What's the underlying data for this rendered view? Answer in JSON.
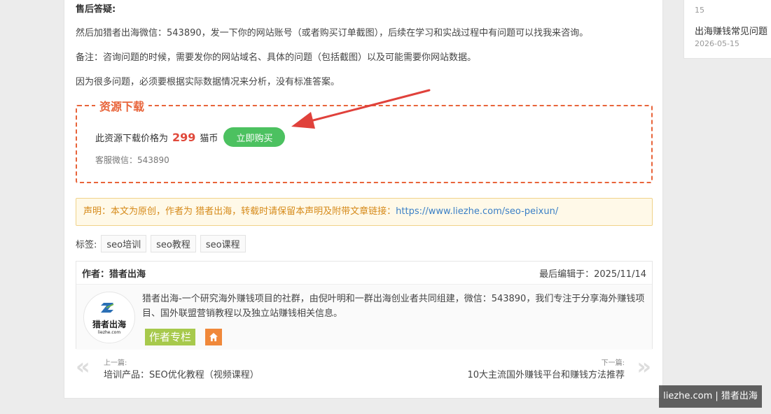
{
  "article": {
    "heading": "售后答疑:",
    "para1": "然后加猎者出海微信：543890，发一下你的网站账号（或者购买订单截图），后续在学习和实战过程中有问题可以找我来咨询。",
    "para2": "备注：咨询问题的时候，需要发你的网站域名、具体的问题（包括截图）以及可能需要你网站数据。",
    "para3": "因为很多问题，必须要根据实际数据情况来分析，没有标准答案。"
  },
  "download": {
    "title": "资源下载",
    "price_prefix": "此资源下载价格为",
    "price": "299",
    "price_unit": "猫币",
    "buy_label": "立即购买",
    "service": "客服微信：543890"
  },
  "notice": {
    "text": "声明：本文为原创，作者为 猎者出海，转载时请保留本声明及附带文章链接：",
    "link": "https://www.liezhe.com/seo-peixun/"
  },
  "tags": {
    "label": "标签:",
    "items": [
      "seo培训",
      "seo教程",
      "seo课程"
    ]
  },
  "author": {
    "name_label": "作者：猎者出海",
    "last_edit": "最后编辑于：2025/11/14",
    "logo_name": "猎者出海",
    "logo_domain": "liezhe.com",
    "description": "猎者出海-一个研究海外赚钱项目的社群，由倪叶明和一群出海创业者共同组建，微信：543890，我们专注于分享海外赚钱项目、国外联盟营销教程以及独立站赚钱相关信息。",
    "column_label": "作者专栏"
  },
  "nav": {
    "prev_label": "上一篇:",
    "prev_title": "培训产品：SEO优化教程（视频课程）",
    "next_label": "下一篇:",
    "next_title": "10大主流国外赚钱平台和赚钱方法推荐"
  },
  "sidebar": {
    "top_num": "15",
    "item_title": "出海赚钱常见问题",
    "item_date": "2026-05-15"
  },
  "watermark": "liezhe.com | 猎者出海",
  "colors": {
    "accent_orange": "#e8643a",
    "buy_green": "#4cc160",
    "link_blue": "#3a7fc6",
    "arrow_red": "#e0413b"
  }
}
